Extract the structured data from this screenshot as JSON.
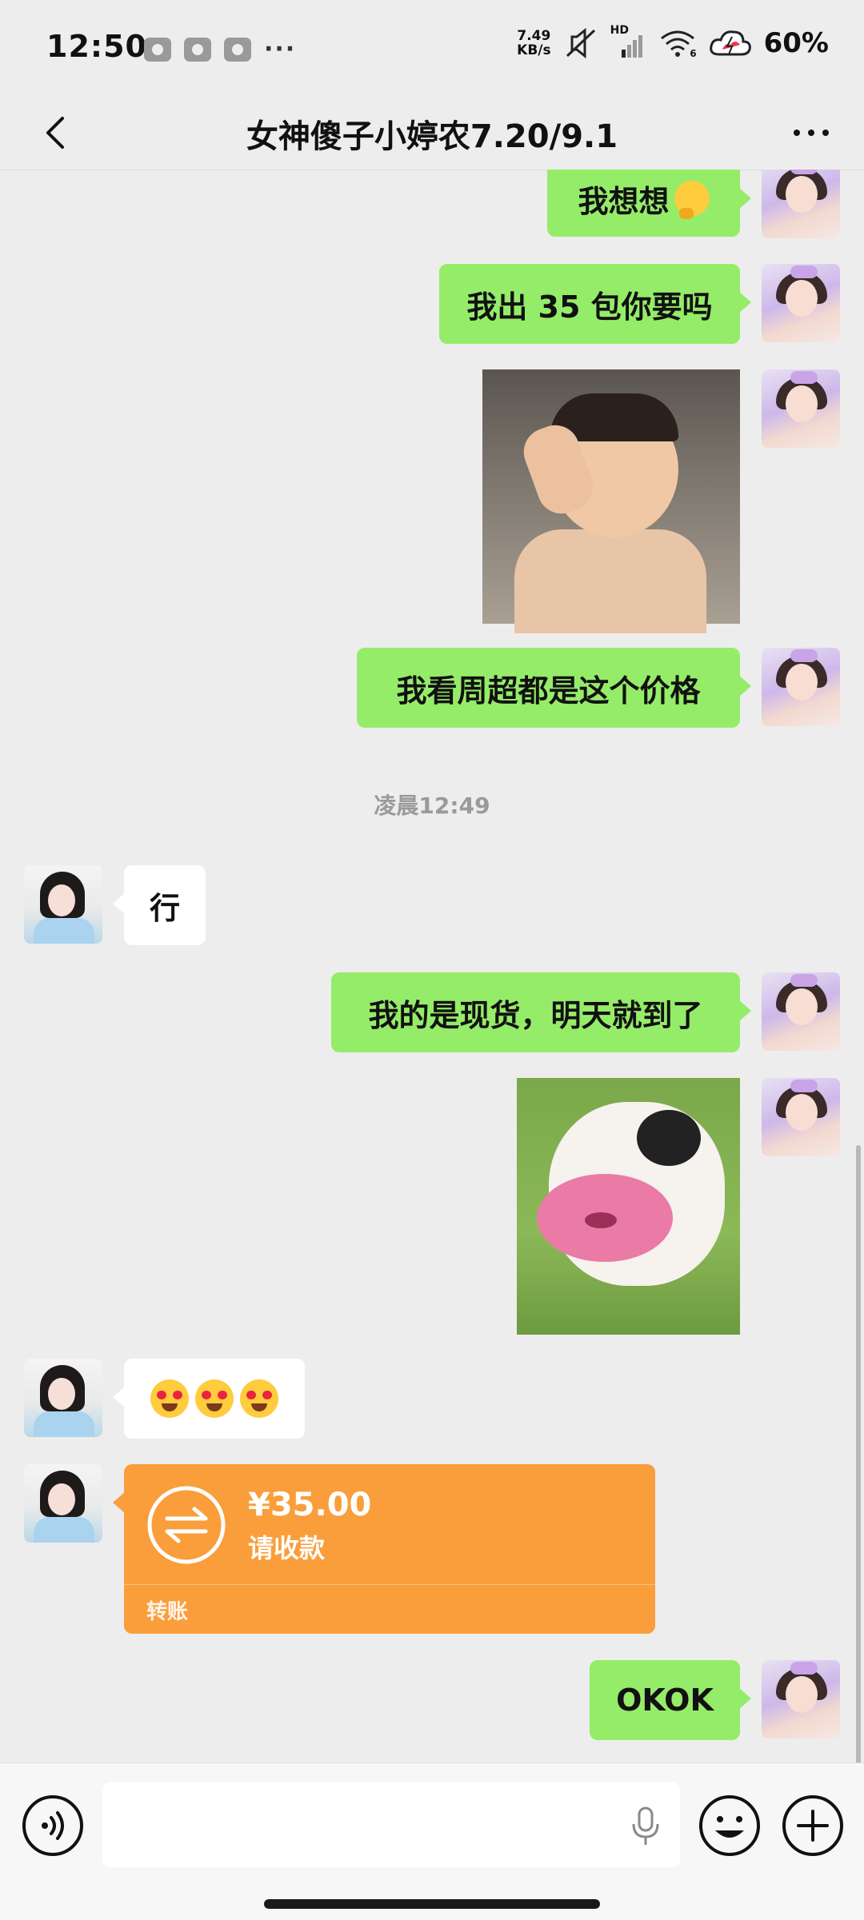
{
  "status_bar": {
    "time": "12:50",
    "net_speed_value": "7.49",
    "net_speed_unit": "KB/s",
    "hd_label": "HD",
    "wifi_label": "6",
    "battery": "60%"
  },
  "nav": {
    "title": "女神傻子小婷农7.20/9.1"
  },
  "messages": [
    {
      "sender": "me",
      "type": "text",
      "text": "我想想",
      "emoji": "thinking-face"
    },
    {
      "sender": "me",
      "type": "text",
      "text": "我出 35 包你要吗"
    },
    {
      "sender": "me",
      "type": "sticker",
      "description": "baby-sticker"
    },
    {
      "sender": "me",
      "type": "text",
      "text": "我看周超都是这个价格"
    },
    {
      "sender": "system",
      "type": "timestamp",
      "text": "凌晨12:49"
    },
    {
      "sender": "her",
      "type": "text",
      "text": "行"
    },
    {
      "sender": "me",
      "type": "text",
      "text": "我的是现货，明天就到了"
    },
    {
      "sender": "me",
      "type": "sticker",
      "description": "cow-lips-sticker"
    },
    {
      "sender": "her",
      "type": "emoji",
      "emoji": "drooling-heart-eyes-face x3"
    },
    {
      "sender": "her",
      "type": "transfer",
      "amount": "¥35.00",
      "status": "请收款",
      "label": "转账"
    },
    {
      "sender": "me",
      "type": "text",
      "text": "OKOK"
    }
  ],
  "colors": {
    "my_bubble": "#95ec69",
    "her_bubble": "#ffffff",
    "transfer": "#fa9e3b",
    "background": "#ededed"
  }
}
